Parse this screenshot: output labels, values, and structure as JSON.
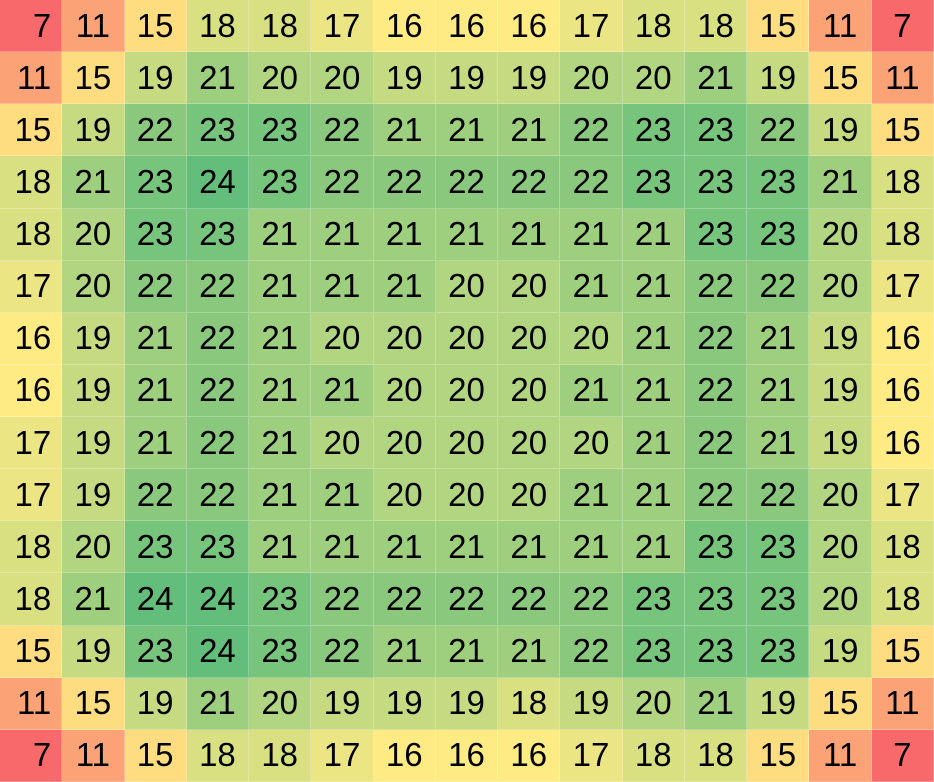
{
  "chart_data": {
    "type": "heatmap",
    "title": "",
    "xlabel": "",
    "ylabel": "",
    "color_scale": {
      "min": 7,
      "mid": 16,
      "max": 24,
      "min_color": "#f8696b",
      "mid_color": "#ffeb84",
      "max_color": "#63be7b"
    },
    "rows": [
      [
        7,
        11,
        15,
        18,
        18,
        17,
        16,
        16,
        16,
        17,
        18,
        18,
        15,
        11,
        7
      ],
      [
        11,
        15,
        19,
        21,
        20,
        20,
        19,
        19,
        19,
        20,
        20,
        21,
        19,
        15,
        11
      ],
      [
        15,
        19,
        22,
        23,
        23,
        22,
        21,
        21,
        21,
        22,
        23,
        23,
        22,
        19,
        15
      ],
      [
        18,
        21,
        23,
        24,
        23,
        22,
        22,
        22,
        22,
        22,
        23,
        23,
        23,
        21,
        18
      ],
      [
        18,
        20,
        23,
        23,
        21,
        21,
        21,
        21,
        21,
        21,
        21,
        23,
        23,
        20,
        18
      ],
      [
        17,
        20,
        22,
        22,
        21,
        21,
        21,
        20,
        20,
        21,
        21,
        22,
        22,
        20,
        17
      ],
      [
        16,
        19,
        21,
        22,
        21,
        20,
        20,
        20,
        20,
        20,
        21,
        22,
        21,
        19,
        16
      ],
      [
        16,
        19,
        21,
        22,
        21,
        21,
        20,
        20,
        20,
        21,
        21,
        22,
        21,
        19,
        16
      ],
      [
        17,
        19,
        21,
        22,
        21,
        20,
        20,
        20,
        20,
        20,
        21,
        22,
        21,
        19,
        16
      ],
      [
        17,
        19,
        22,
        22,
        21,
        21,
        20,
        20,
        20,
        21,
        21,
        22,
        22,
        20,
        17
      ],
      [
        18,
        20,
        23,
        23,
        21,
        21,
        21,
        21,
        21,
        21,
        21,
        23,
        23,
        20,
        18
      ],
      [
        18,
        21,
        24,
        24,
        23,
        22,
        22,
        22,
        22,
        22,
        23,
        23,
        23,
        20,
        18
      ],
      [
        15,
        19,
        23,
        24,
        23,
        22,
        21,
        21,
        21,
        22,
        23,
        23,
        23,
        19,
        15
      ],
      [
        11,
        15,
        19,
        21,
        20,
        19,
        19,
        19,
        18,
        19,
        20,
        21,
        19,
        15,
        11
      ],
      [
        7,
        11,
        15,
        18,
        18,
        17,
        16,
        16,
        16,
        17,
        18,
        18,
        15,
        11,
        7
      ]
    ]
  }
}
